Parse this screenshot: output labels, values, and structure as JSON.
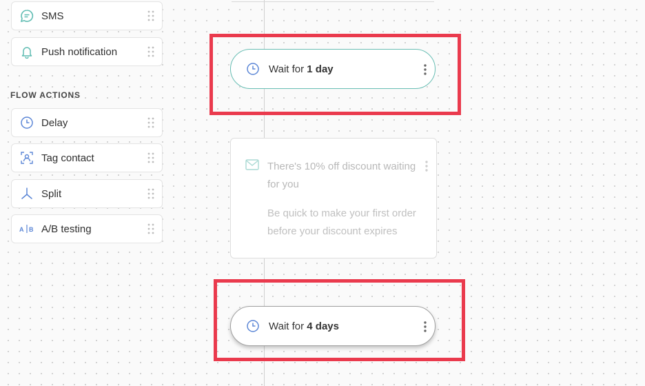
{
  "sidebar": {
    "channel_items": [
      {
        "label": "SMS",
        "icon": "sms-icon"
      },
      {
        "label": "Push notification",
        "icon": "bell-icon"
      }
    ],
    "section_title": "FLOW ACTIONS",
    "action_items": [
      {
        "label": "Delay",
        "icon": "clock-icon"
      },
      {
        "label": "Tag contact",
        "icon": "tag-contact-icon"
      },
      {
        "label": "Split",
        "icon": "split-icon"
      },
      {
        "label": "A/B testing",
        "icon": "ab-testing-icon"
      }
    ]
  },
  "flow": {
    "step1": {
      "prefix": "Wait for ",
      "value": "1 day"
    },
    "email": {
      "subject": "There's 10% off discount waiting for you",
      "preview": "Be quick to make your first order before your discount expires"
    },
    "step2": {
      "prefix": "Wait for ",
      "value": "4 days"
    }
  },
  "colors": {
    "accent_teal": "#67bdb3",
    "icon_blue": "#5b86d6",
    "highlight_red": "#ea3a4d"
  }
}
